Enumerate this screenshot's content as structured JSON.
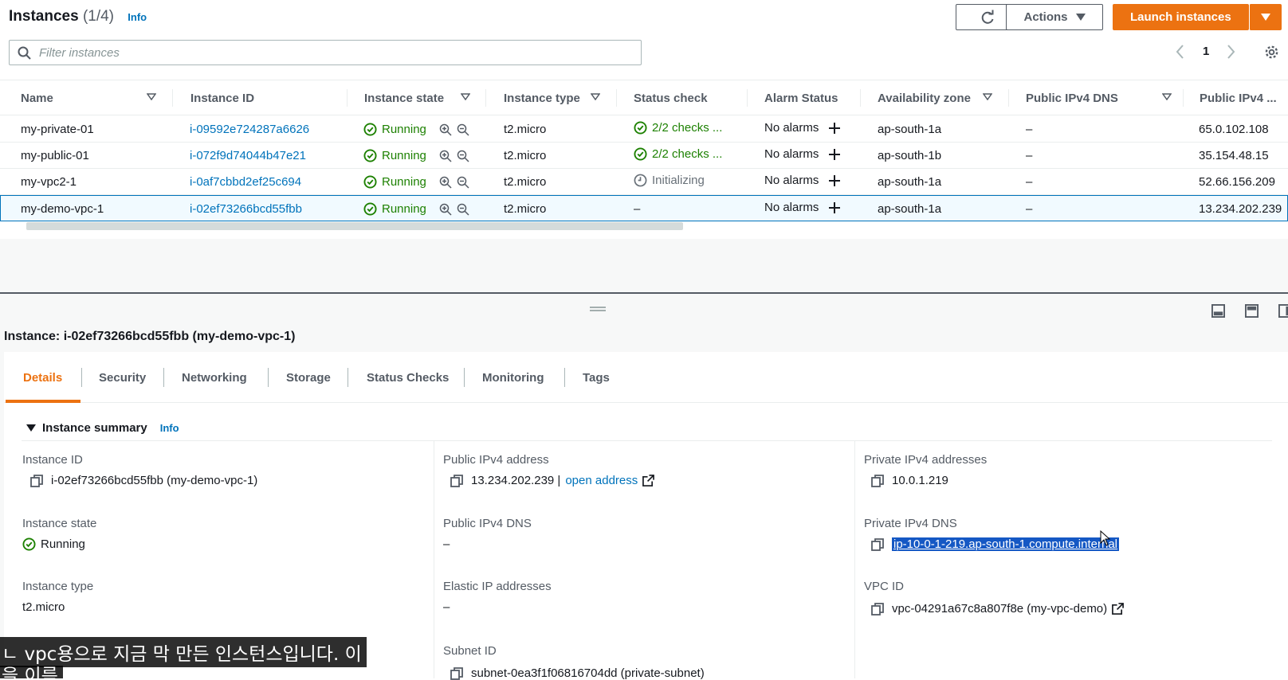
{
  "header": {
    "title": "Instances",
    "count": "(1/4)",
    "info": "Info",
    "actions_label": "Actions",
    "launch_label": "Launch instances",
    "search_placeholder": "Filter instances",
    "page_number": "1"
  },
  "table": {
    "columns": [
      "Name",
      "Instance ID",
      "Instance state",
      "Instance type",
      "Status check",
      "Alarm Status",
      "Availability zone",
      "Public IPv4 DNS",
      "Public IPv4 ..."
    ],
    "rows": [
      {
        "name": "my-private-01",
        "id": "i-09592e724287a6626",
        "state": "Running",
        "type": "t2.micro",
        "status": "2/2 checks ...",
        "alarm": "No alarms",
        "az": "ap-south-1a",
        "dns": "–",
        "ip": "65.0.102.108"
      },
      {
        "name": "my-public-01",
        "id": "i-072f9d74044b47e21",
        "state": "Running",
        "type": "t2.micro",
        "status": "2/2 checks ...",
        "alarm": "No alarms",
        "az": "ap-south-1b",
        "dns": "–",
        "ip": "35.154.48.15"
      },
      {
        "name": "my-vpc2-1",
        "id": "i-0af7cbbd2ef25c694",
        "state": "Running",
        "type": "t2.micro",
        "status": "Initializing",
        "alarm": "No alarms",
        "az": "ap-south-1a",
        "dns": "–",
        "ip": "52.66.156.209"
      },
      {
        "name": "my-demo-vpc-1",
        "id": "i-02ef73266bcd55fbb",
        "state": "Running",
        "type": "t2.micro",
        "status": "–",
        "alarm": "No alarms",
        "az": "ap-south-1a",
        "dns": "–",
        "ip": "13.234.202.239"
      }
    ]
  },
  "details": {
    "title": "Instance: i-02ef73266bcd55fbb (my-demo-vpc-1)",
    "tabs": [
      "Details",
      "Security",
      "Networking",
      "Storage",
      "Status Checks",
      "Monitoring",
      "Tags"
    ],
    "summary_title": "Instance summary",
    "summary_info": "Info",
    "instance_id_label": "Instance ID",
    "instance_id_value": "i-02ef73266bcd55fbb (my-demo-vpc-1)",
    "instance_state_label": "Instance state",
    "instance_state_value": "Running",
    "instance_type_label": "Instance type",
    "instance_type_value": "t2.micro",
    "public_ipv4_label": "Public IPv4 address",
    "public_ipv4_value": "13.234.202.239 |",
    "open_address": "open address",
    "public_dns_label": "Public IPv4 DNS",
    "public_dns_value": "–",
    "elastic_ip_label": "Elastic IP addresses",
    "elastic_ip_value": "–",
    "subnet_label": "Subnet ID",
    "subnet_value": "subnet-0ea3f1f06816704dd (private-subnet)",
    "private_ipv4_label": "Private IPv4 addresses",
    "private_ipv4_value": "10.0.1.219",
    "private_dns_label": "Private IPv4 DNS",
    "private_dns_value": "ip-10-0-1-219.ap-south-1.compute.internal",
    "vpc_label": "VPC ID",
    "vpc_value": "vpc-04291a67c8a807f8e (my-vpc-demo)"
  },
  "subtitle": {
    "line1": "ㄴ vpc용으로 지금 막 만든 인스턴스입니다. 이",
    "line2": "을 이름"
  },
  "colors": {
    "accent": "#ec7211",
    "link": "#0073bb",
    "success": "#1d8102"
  }
}
